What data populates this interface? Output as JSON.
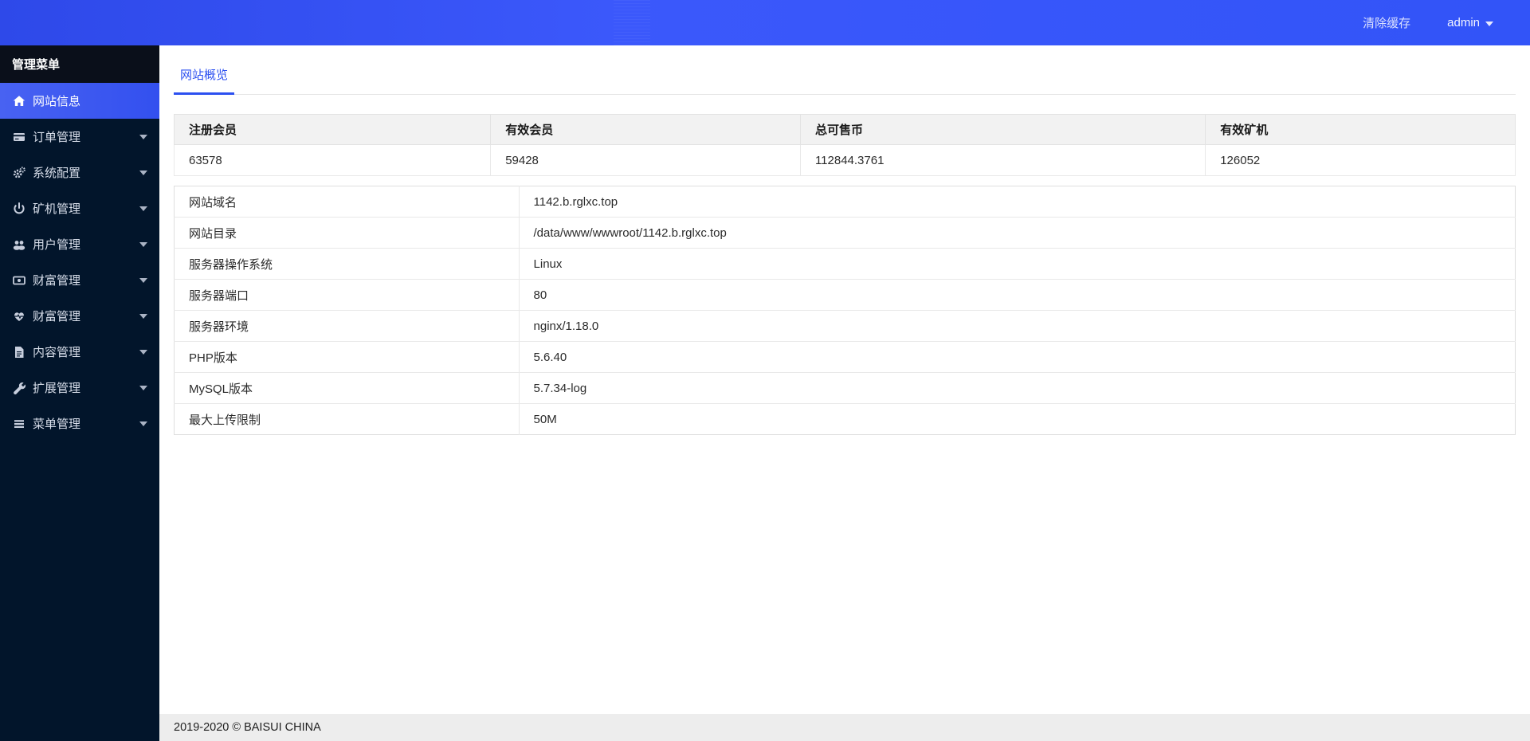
{
  "topbar": {
    "clear_cache_label": "清除缓存",
    "user_menu_label": "admin"
  },
  "sidebar": {
    "header": "管理菜单",
    "items": [
      {
        "label": "网站信息",
        "icon": "home-icon",
        "active": true,
        "expandable": false
      },
      {
        "label": "订单管理",
        "icon": "credit-card-icon",
        "active": false,
        "expandable": true
      },
      {
        "label": "系统配置",
        "icon": "gears-icon",
        "active": false,
        "expandable": true
      },
      {
        "label": "矿机管理",
        "icon": "power-icon",
        "active": false,
        "expandable": true
      },
      {
        "label": "用户管理",
        "icon": "users-icon",
        "active": false,
        "expandable": true
      },
      {
        "label": "财富管理",
        "icon": "money-icon",
        "active": false,
        "expandable": true
      },
      {
        "label": "财富管理",
        "icon": "heartbeat-icon",
        "active": false,
        "expandable": true
      },
      {
        "label": "内容管理",
        "icon": "file-text-icon",
        "active": false,
        "expandable": true
      },
      {
        "label": "扩展管理",
        "icon": "wrench-icon",
        "active": false,
        "expandable": true
      },
      {
        "label": "菜单管理",
        "icon": "list-icon",
        "active": false,
        "expandable": true
      }
    ]
  },
  "tabs": [
    {
      "label": "网站概览",
      "active": true
    }
  ],
  "stats_table": {
    "headers": [
      "注册会员",
      "有效会员",
      "总可售币",
      "有效矿机"
    ],
    "values": [
      "63578",
      "59428",
      "112844.3761",
      "126052"
    ]
  },
  "info_table": {
    "rows": [
      {
        "label": "网站域名",
        "value": "1142.b.rglxc.top"
      },
      {
        "label": "网站目录",
        "value": "/data/www/wwwroot/1142.b.rglxc.top"
      },
      {
        "label": "服务器操作系统",
        "value": "Linux"
      },
      {
        "label": "服务器端口",
        "value": "80"
      },
      {
        "label": "服务器环境",
        "value": "nginx/1.18.0"
      },
      {
        "label": "PHP版本",
        "value": "5.6.40"
      },
      {
        "label": "MySQL版本",
        "value": "5.7.34-log"
      },
      {
        "label": "最大上传限制",
        "value": "50M"
      }
    ]
  },
  "footer": {
    "copyright": "2019-2020 © BAISUI CHINA"
  },
  "colors": {
    "accent": "#2c50f0",
    "topbar_blue": "#3254f8",
    "sidebar_bg": "#02152b",
    "active_item_gradient_start": "#4862f2",
    "active_item_gradient_end": "#3350ef",
    "table_header_bg": "#f2f2f2",
    "footer_bg": "#ededed"
  }
}
